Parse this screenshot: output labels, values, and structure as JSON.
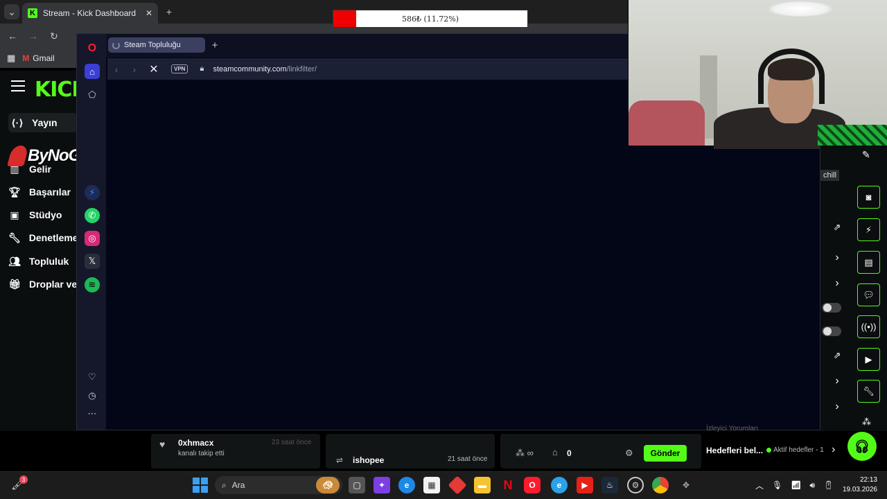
{
  "chrome": {
    "tab_title": "Stream - Kick Dashboard",
    "bookmark_gmail": "Gmail"
  },
  "kick": {
    "logo": "KICK",
    "nav": [
      {
        "label": "Yayın",
        "icon": "broadcast-icon"
      },
      {
        "label": "Gelir",
        "icon": "revenue-icon"
      },
      {
        "label": "Başarılar",
        "icon": "trophy-icon"
      },
      {
        "label": "Stüdyo",
        "icon": "studio-icon"
      },
      {
        "label": "Denetleme",
        "icon": "wrench-icon"
      },
      {
        "label": "Topluluk",
        "icon": "community-icon"
      },
      {
        "label": "Droplar ve",
        "icon": "drops-icon"
      }
    ],
    "overlay_brand": "ByNoGame"
  },
  "opera": {
    "tab_title": "Steam Topluluğu",
    "vpn_label": "VPN",
    "url_host": "steamcommunity.com",
    "url_path": "/linkfilter/",
    "sidebar_icons": [
      "opera-logo-icon",
      "home-icon",
      "pinboard-icon",
      "messenger-icon",
      "whatsapp-icon",
      "instagram-icon",
      "x-icon",
      "spotify-icon",
      "heart-icon",
      "history-icon",
      "more-icon"
    ]
  },
  "donation": {
    "progress_text": "586₺ (11.72%)",
    "progress": 0.1172,
    "fill_color": "#ee0000"
  },
  "right_panel": {
    "tag": "chill"
  },
  "bottom": {
    "follower_name": "0xhmacx",
    "follower_action": "kanalı takip etti",
    "follower_time": "23 saat önce",
    "sub_name": "ishopee",
    "sub_time": "21 saat önce",
    "store_count": "0",
    "send_label": "Gönder",
    "goals_title": "Hedefleri bel...",
    "goals_active": "Aktif hedefler - 1",
    "faded_label": "İzleyici Yorumları"
  },
  "taskbar": {
    "search_label": "Ara",
    "notification_badge": "3",
    "time": "22:13",
    "date": "19.03.2026"
  },
  "colors": {
    "kick_green": "#53fc18",
    "opera_bg": "#030617"
  }
}
